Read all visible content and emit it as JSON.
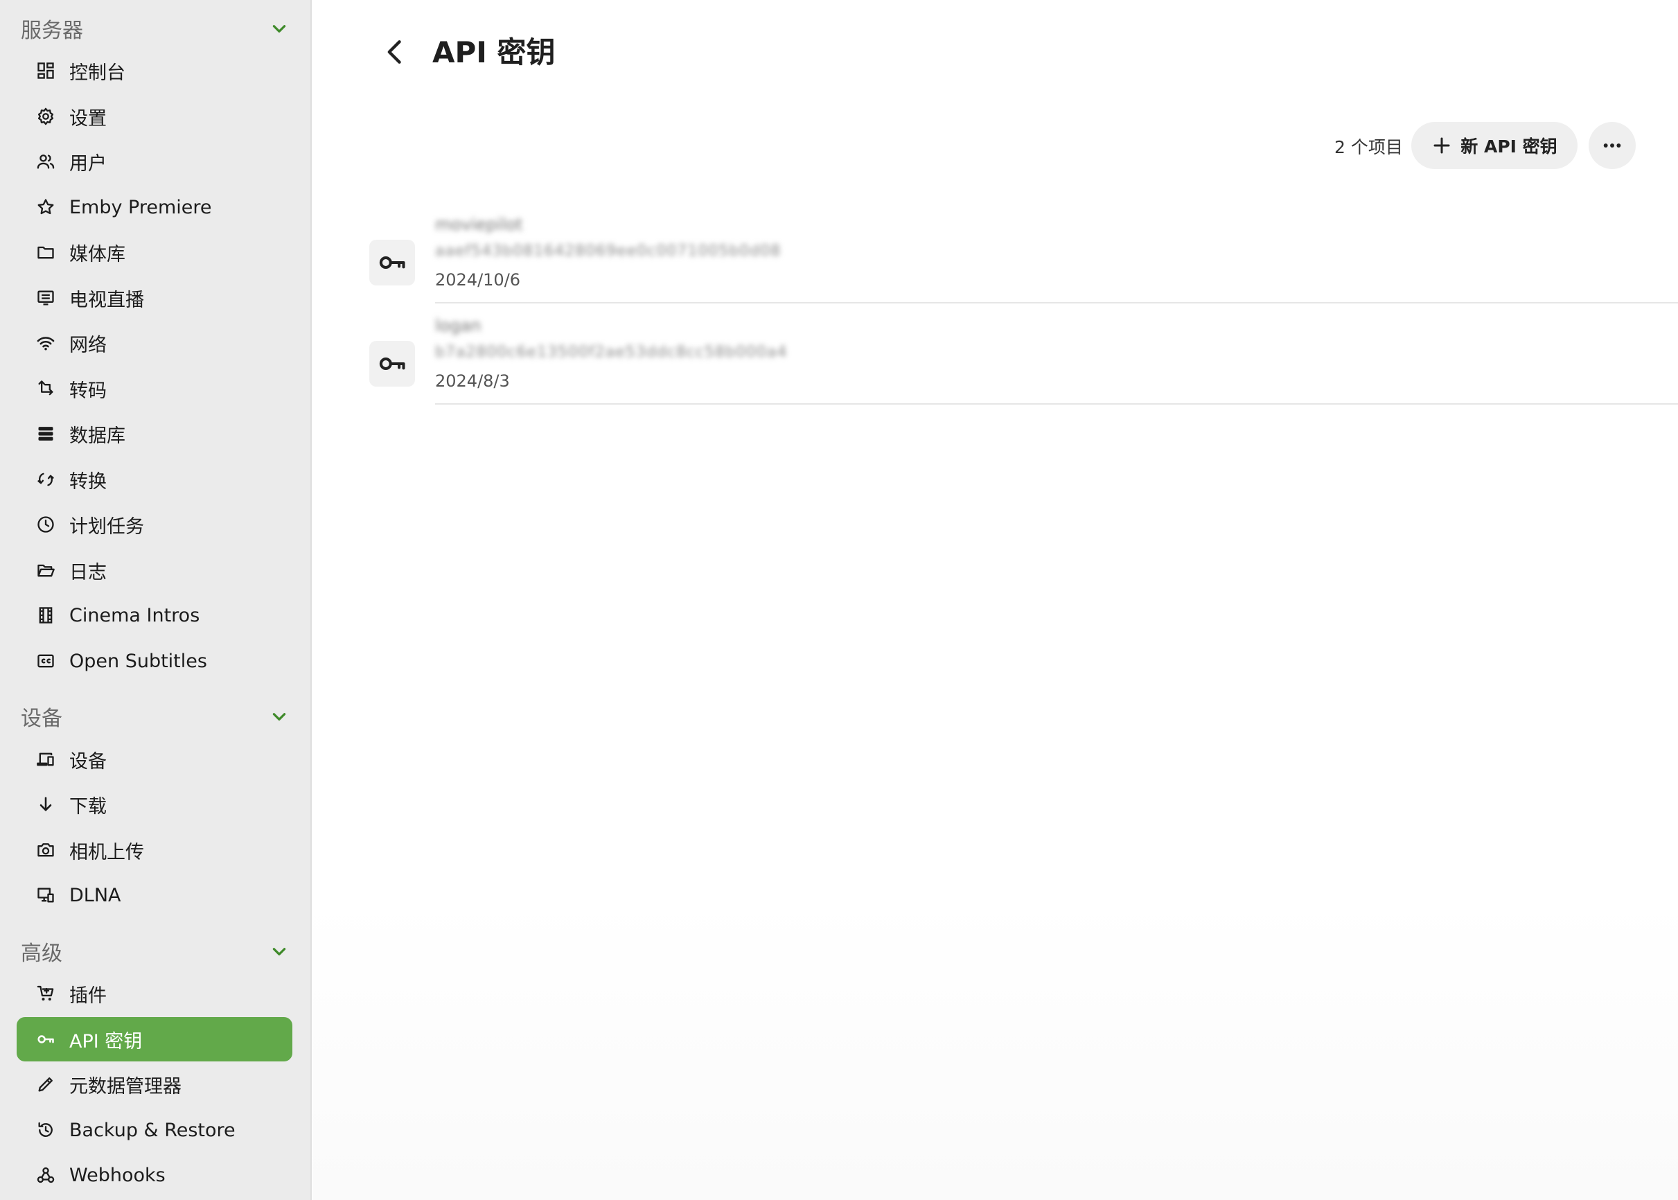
{
  "sidebar": {
    "sections": {
      "server": "服务器",
      "devices": "设备",
      "advanced": "高级"
    },
    "items": [
      {
        "label": "控制台",
        "icon": "dashboard-icon"
      },
      {
        "label": "设置",
        "icon": "gear-icon"
      },
      {
        "label": "用户",
        "icon": "users-icon"
      },
      {
        "label": "Emby Premiere",
        "icon": "star-icon"
      },
      {
        "label": "媒体库",
        "icon": "folder-icon"
      },
      {
        "label": "电视直播",
        "icon": "tv-guide-icon"
      },
      {
        "label": "网络",
        "icon": "wifi-icon"
      },
      {
        "label": "转码",
        "icon": "transcode-icon"
      },
      {
        "label": "数据库",
        "icon": "database-icon"
      },
      {
        "label": "转换",
        "icon": "convert-icon"
      },
      {
        "label": "计划任务",
        "icon": "clock-icon"
      },
      {
        "label": "日志",
        "icon": "folder-open-icon"
      },
      {
        "label": "Cinema Intros",
        "icon": "film-icon"
      },
      {
        "label": "Open Subtitles",
        "icon": "cc-icon"
      },
      {
        "label": "设备",
        "icon": "devices-icon"
      },
      {
        "label": "下载",
        "icon": "download-icon"
      },
      {
        "label": "相机上传",
        "icon": "camera-icon"
      },
      {
        "label": "DLNA",
        "icon": "dlna-icon"
      },
      {
        "label": "插件",
        "icon": "cart-icon"
      },
      {
        "label": "API 密钥",
        "icon": "key-icon",
        "active": true
      },
      {
        "label": "元数据管理器",
        "icon": "pencil-icon"
      },
      {
        "label": "Backup & Restore",
        "icon": "restore-icon"
      },
      {
        "label": "Webhooks",
        "icon": "webhook-icon"
      }
    ]
  },
  "header": {
    "title": "API 密钥"
  },
  "toolbar": {
    "count": "2 个项目",
    "new_label": "新 API 密钥"
  },
  "keys": [
    {
      "name": "moviepilot",
      "value": "aaef543b0816428069ee0c0071005b0d08",
      "date": "2024/10/6"
    },
    {
      "name": "logan",
      "value": "b7a2800c6e13500f2ae53ddc8cc58b000a4",
      "date": "2024/8/3"
    }
  ],
  "colors": {
    "accent": "#62a94a",
    "sidebar_bg": "#ebebeb",
    "chevron": "#3f8a2a"
  }
}
